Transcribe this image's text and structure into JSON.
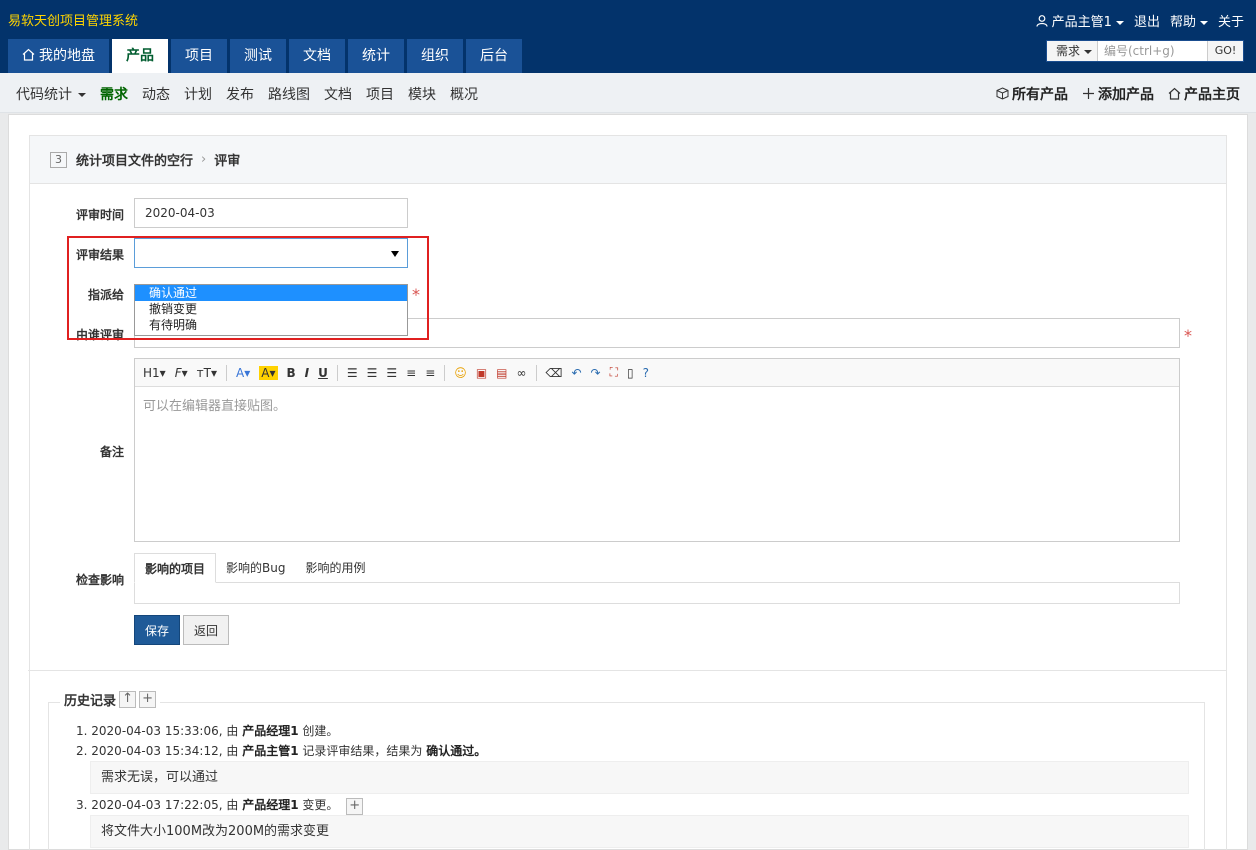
{
  "app": {
    "title": "易软天创项目管理系统"
  },
  "topbar": {
    "user": "产品主管1",
    "logout": "退出",
    "help": "帮助",
    "about": "关于"
  },
  "mainnav": [
    "我的地盘",
    "产品",
    "项目",
    "测试",
    "文档",
    "统计",
    "组织",
    "后台"
  ],
  "search": {
    "type": "需求",
    "placeholder": "编号(ctrl+g)",
    "go": "GO!"
  },
  "subnav": {
    "left": [
      "代码统计",
      "需求",
      "动态",
      "计划",
      "发布",
      "路线图",
      "文档",
      "项目",
      "模块",
      "概况"
    ],
    "right": [
      "所有产品",
      "添加产品",
      "产品主页"
    ]
  },
  "page": {
    "story_id": "3",
    "story_title": "统计项目文件的空行",
    "action": "评审"
  },
  "form": {
    "review_date_label": "评审时间",
    "review_date": "2020-04-03",
    "result_label": "评审结果",
    "result_value": "",
    "result_options": [
      "确认通过",
      "撤销变更",
      "有待明确"
    ],
    "assign_label": "指派给",
    "reviewer_label": "由谁评审",
    "comment_label": "备注",
    "editor_placeholder": "可以在编辑器直接贴图。",
    "impact_label": "检查影响",
    "impact_tabs": [
      "影响的项目",
      "影响的Bug",
      "影响的用例"
    ],
    "save": "保存",
    "back": "返回"
  },
  "toolbar": [
    "H1",
    "F",
    "тT",
    "A",
    "A",
    "B",
    "I",
    "U"
  ],
  "history": {
    "title": "历史记录",
    "items": [
      {
        "num": "1.",
        "time": "2020-04-03 15:33:06, 由 ",
        "who": "产品经理1",
        "action": " 创建。",
        "extra": ""
      },
      {
        "num": "2.",
        "time": "2020-04-03 15:34:12, 由 ",
        "who": "产品主管1",
        "action": " 记录评审结果，结果为 ",
        "extra": "确认通过。"
      },
      {
        "num": "3.",
        "time": "2020-04-03 17:22:05, 由 ",
        "who": "产品经理1",
        "action": " 变更。",
        "extra": ""
      }
    ],
    "notes": [
      "需求无误，可以通过",
      "将文件大小100M改为200M的需求变更"
    ]
  }
}
